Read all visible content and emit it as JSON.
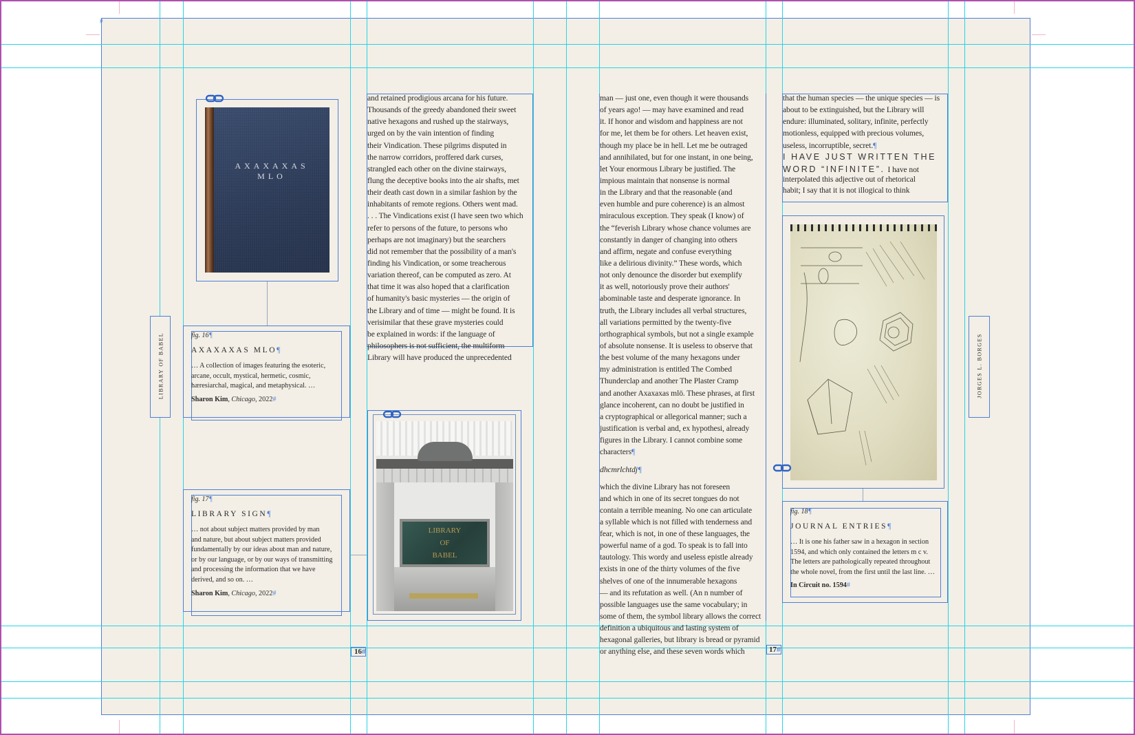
{
  "spread": {
    "left_page_number": "16",
    "right_page_number": "17",
    "left_sidebar_label": "LIBRARY OF BABEL",
    "right_sidebar_label": "JORGES L. BORGES"
  },
  "colors": {
    "paper": "#f3efe6",
    "frame": "#4d7fd6",
    "guide": "#27d3e8",
    "pasteboard_edge": "#b04fb0",
    "book_cover": "#2d3c59"
  },
  "book_cover": {
    "title_line1": "AXAXAXAS",
    "title_line2": "MLO"
  },
  "library_sign": {
    "line1": "LIBRARY",
    "line2": "OF",
    "line3": "BABEL"
  },
  "captions": [
    {
      "fig": "fig. 16",
      "title": "AXAXAXAS MLO",
      "body": [
        "… A collection of images featuring the esoteric,",
        "arcane, occult, mystical, hermetic, cosmic,",
        "hæresiarchal, magical, and metaphysical. …"
      ],
      "credit_name": "Sharon Kim",
      "credit_place": "Chicago",
      "credit_year": ", 2022"
    },
    {
      "fig": "fig. 17",
      "title": "LIBRARY SIGN",
      "body": [
        "… not about subject matters provided by man",
        "and nature, but about subject matters provided",
        "fundamentally by our ideas about man and nature,",
        "or by our language, or by our ways of transmitting",
        "and processing the information that we have",
        "derived, and so on. …"
      ],
      "credit_name": "Sharon Kim",
      "credit_place": "Chicago",
      "credit_year": ", 2022"
    },
    {
      "fig": "fig. 18",
      "title": "JOURNAL ENTRIES",
      "body": [
        "… It is one his father saw in a hexagon in section",
        "1594, and which only contained the letters m c v.",
        "The letters are pathologically repeated throughout",
        "the whole novel, from the first until the last line. …"
      ],
      "credit_name": "In Circuit no. 1594",
      "credit_place": "",
      "credit_year": ""
    }
  ],
  "column_a": [
    "and retained prodigious arcana for his future.",
    "Thousands of the greedy abandoned their sweet",
    "native hexagons and rushed up the stairways,",
    "urged on by the vain intention of finding",
    "their Vindication. These pilgrims disputed in",
    "the narrow corridors, proffered dark curses,",
    "strangled each other on the divine stairways,",
    "flung the deceptive books into the air shafts, met",
    "their death cast down in a similar fashion by the",
    "inhabitants of remote regions. Others went mad.",
    ". . . The Vindications exist (I have seen two which",
    "refer to persons of the future, to persons who",
    "perhaps are not imaginary) but the searchers",
    "did not remember that the possibility of a man's",
    "finding his Vindication, or some treacherous",
    "variation thereof, can be computed as zero. At",
    "that time it was also hoped that a clarification",
    "of humanity's basic mysteries — the origin of",
    "the Library and of time — might be found. It is",
    "verisimilar that these grave mysteries could",
    "be explained in words: if the language of",
    "philosophers is not sufficient, the multiform",
    "Library will have produced the unprecedented"
  ],
  "column_b": [
    "man — just one, even though it were thousands",
    "of years ago! — may have examined and read",
    "it. If honor and wisdom and happiness are not",
    "for me, let them be for others. Let heaven exist,",
    "though my place be in hell. Let me be outraged",
    "and annihilated, but for one instant, in one being,",
    "let Your enormous Library be justified. The",
    "impious maintain that nonsense is normal",
    "in the Library and that the reasonable (and",
    "even humble and pure coherence) is an almost",
    "miraculous exception. They speak (I know) of",
    "the “feverish Library whose chance volumes are",
    "constantly in danger of changing into others",
    "and affirm, negate and confuse everything",
    "like a delirious divinity.” These words, which",
    "not only denounce the disorder but exemplify",
    "it as well, notoriously prove their authors'",
    "abominable taste and desperate ignorance. In",
    "truth, the Library includes all verbal structures,",
    "all variations permitted by the twenty-five",
    "orthographical symbols, but not a single example",
    "of absolute nonsense. It is useless to observe that",
    "the best volume of the many hexagons under",
    "my administration is entitled The Combed",
    "Thunderclap and another The Plaster Cramp",
    "and another Axaxaxas mlö. These phrases, at first",
    "glance incoherent, can no doubt be justified in",
    "a cryptographical or allegorical manner; such a",
    "justification is verbal and, ex hypothesi, already",
    "figures in the Library. I cannot combine some",
    "characters"
  ],
  "column_b_code": "dhcmrlchtdj",
  "column_b_cont": [
    "which the divine Library has not foreseen",
    "and which in one of its secret tongues do not",
    "contain a terrible meaning. No one can articulate",
    "a syllable which is not filled with tenderness and",
    "fear, which is not, in one of these languages, the",
    "powerful name of a god. To speak is to fall into",
    "tautology. This wordy and useless epistle already",
    "exists in one of the thirty volumes of the five",
    "shelves of one of the innumerable hexagons",
    "— and its refutation as well. (An n number of",
    "possible languages use the same vocabulary; in",
    "some of them, the symbol library allows the correct",
    "definition a ubiquitous and  lasting system of",
    "hexagonal galleries, but library is bread or pyramid",
    "or anything else, and these seven words which"
  ],
  "column_c": [
    "that the human species — the unique species — is",
    "about to be extinguished, but the Library will",
    "endure: illuminated, solitary, infinite, perfectly",
    "motionless, equipped with precious volumes,",
    "useless, incorruptible, secret."
  ],
  "column_c_heading": "I HAVE JUST WRITTEN THE WORD “INFINITE”.",
  "column_c_after_heading": [
    "I have not",
    "interpolated this adjective out of rhetorical",
    "habit; I say that it is not illogical to think"
  ],
  "column_c_heading_line1": "I HAVE JUST WRITTEN THE",
  "column_c_heading_line2": "WORD “INFINITE”."
}
